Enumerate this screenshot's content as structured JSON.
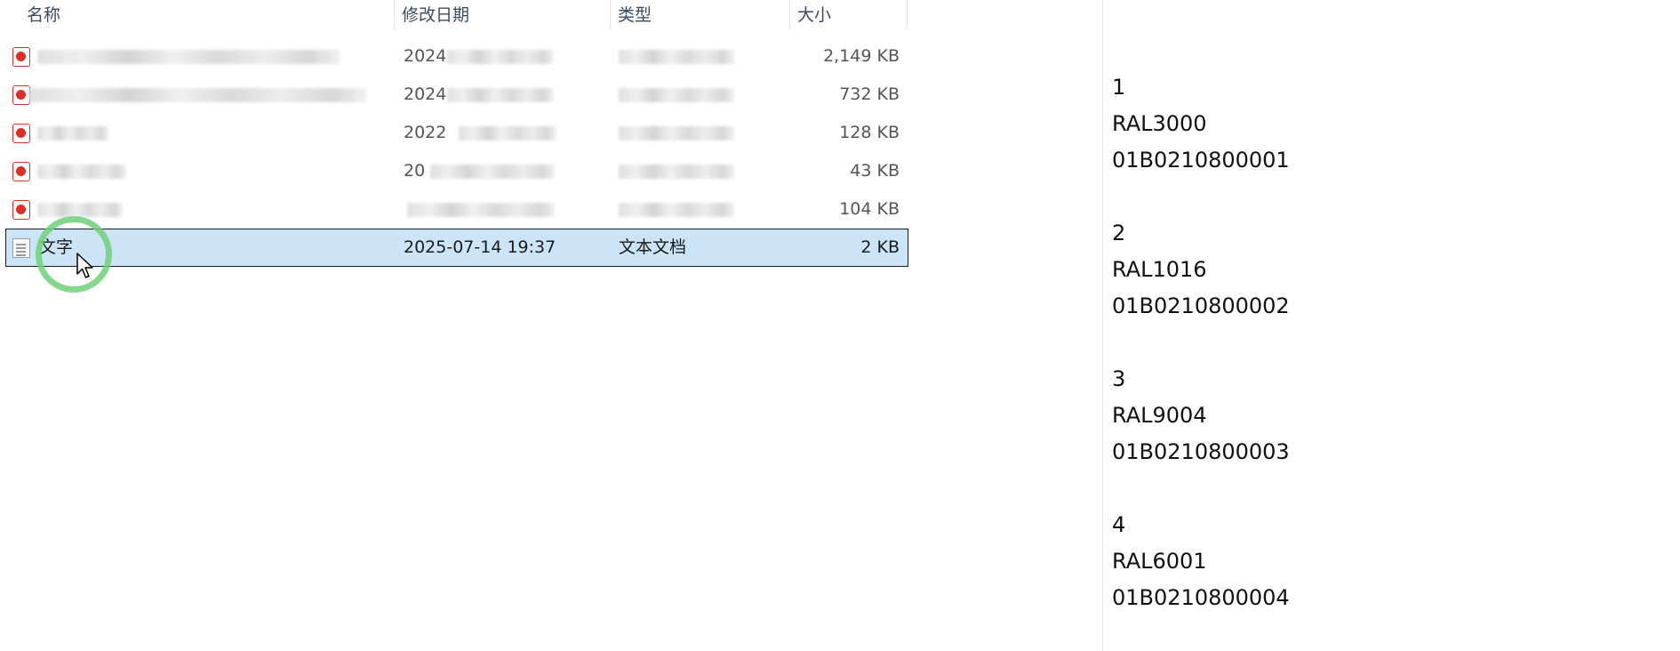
{
  "columns": {
    "name": "名称",
    "date": "修改日期",
    "type": "类型",
    "size": "大小"
  },
  "files": [
    {
      "name": "",
      "date": "2024",
      "type": "",
      "size": "2,149 KB",
      "icon": "pdf-icon"
    },
    {
      "name": "",
      "date": "2024",
      "type": "",
      "size": "732 KB",
      "icon": "pdf-icon"
    },
    {
      "name": "",
      "date": "2022",
      "type": "",
      "size": "128 KB",
      "icon": "pdf-icon"
    },
    {
      "name": "",
      "date": "20",
      "type": "",
      "size": "43 KB",
      "icon": "pdf-icon"
    },
    {
      "name": "",
      "date": "",
      "type": "",
      "size": "104 KB",
      "icon": "pdf-icon"
    },
    {
      "name": "文字",
      "date": "2025-07-14 19:37",
      "type": "文本文档",
      "size": "2 KB",
      "icon": "text-file-icon",
      "selected": true
    }
  ],
  "text_entries": [
    {
      "index": "1",
      "code": "RAL3000",
      "id": "01B0210800001"
    },
    {
      "index": "2",
      "code": "RAL1016",
      "id": "01B0210800002"
    },
    {
      "index": "3",
      "code": "RAL9004",
      "id": "01B0210800003"
    },
    {
      "index": "4",
      "code": "RAL6001",
      "id": "01B0210800004"
    }
  ],
  "colors": {
    "selection": "#cce4f7",
    "pdf_red": "#d9312a",
    "click_ring": "#6fd17a"
  }
}
